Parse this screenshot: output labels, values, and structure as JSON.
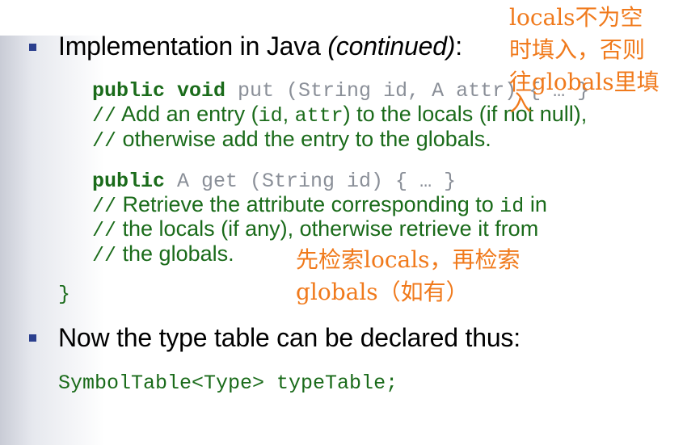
{
  "bullet1": {
    "text": "Implementation in Java ",
    "italic": "(continued)",
    "colon": ":"
  },
  "code": {
    "put_kw": "public void",
    "put_sig": " put (String id, A attr) { … }",
    "put_c1_slash": "//",
    "put_c1_a": " Add an entry (",
    "put_c1_id": "id",
    "put_c1_b": ", ",
    "put_c1_attr": "attr",
    "put_c1_c": ") to the locals (if not null),",
    "put_c2_slash": "//",
    "put_c2": " otherwise add the entry to the globals.",
    "get_kw": "public",
    "get_sig": " A get (String id) { … }",
    "get_c1_slash": "//",
    "get_c1_a": " Retrieve the attribute corresponding to ",
    "get_c1_id": "id",
    "get_c1_b": " in",
    "get_c2_slash": "//",
    "get_c2": " the locals (if any), otherwise retrieve it from",
    "get_c3_slash": "//",
    "get_c3": " the globals.",
    "close_brace": "}"
  },
  "bullet2": {
    "text": "Now the type table can be declared thus:"
  },
  "decl": "SymbolTable<Type> typeTable;",
  "annotations": {
    "put_note_line1": "locals不为空",
    "put_note_line2": "时填入，否则",
    "put_note_line3": "往globals里填",
    "put_note_line4": "入",
    "get_note_line1": "先检索locals，再检索",
    "get_note_line2": "globals（如有）"
  },
  "colors": {
    "code_green": "#1a6b1a",
    "annotation_orange": "#f07a1c",
    "bullet_blue": "#2b3f8e"
  }
}
